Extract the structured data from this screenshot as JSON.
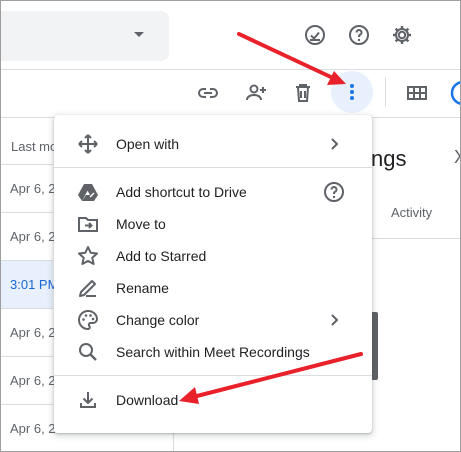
{
  "toolbar": {
    "icons": [
      "link-icon",
      "add-person-icon",
      "trash-icon",
      "more-vert-icon",
      "grid-view-icon",
      "info-icon"
    ],
    "top_icons": [
      "offline-check-icon",
      "help-icon",
      "settings-icon"
    ]
  },
  "file_list": {
    "column_header": "Last mo",
    "rows": [
      {
        "date": "Apr 6, 2",
        "selected": false
      },
      {
        "date": "Apr 6, 2",
        "selected": false
      },
      {
        "date": "3:01 PM",
        "selected": true
      },
      {
        "date": "Apr 6, 2",
        "selected": false
      },
      {
        "date": "Apr 6, 2",
        "selected": false
      },
      {
        "date": "Apr 6, 2",
        "selected": false
      }
    ]
  },
  "details_panel": {
    "title_fragment": "ngs",
    "close_glyph": "X",
    "activity_tab": "Activity"
  },
  "menu": {
    "open_with": "Open with",
    "add_shortcut": "Add shortcut to Drive",
    "move_to": "Move to",
    "add_starred": "Add to Starred",
    "rename": "Rename",
    "change_color": "Change color",
    "search_within": "Search within Meet Recordings",
    "download": "Download"
  },
  "colors": {
    "accent": "#1a73e8",
    "annotation_arrow": "#e8212a",
    "selected_row_bg": "#e8f0fe"
  }
}
